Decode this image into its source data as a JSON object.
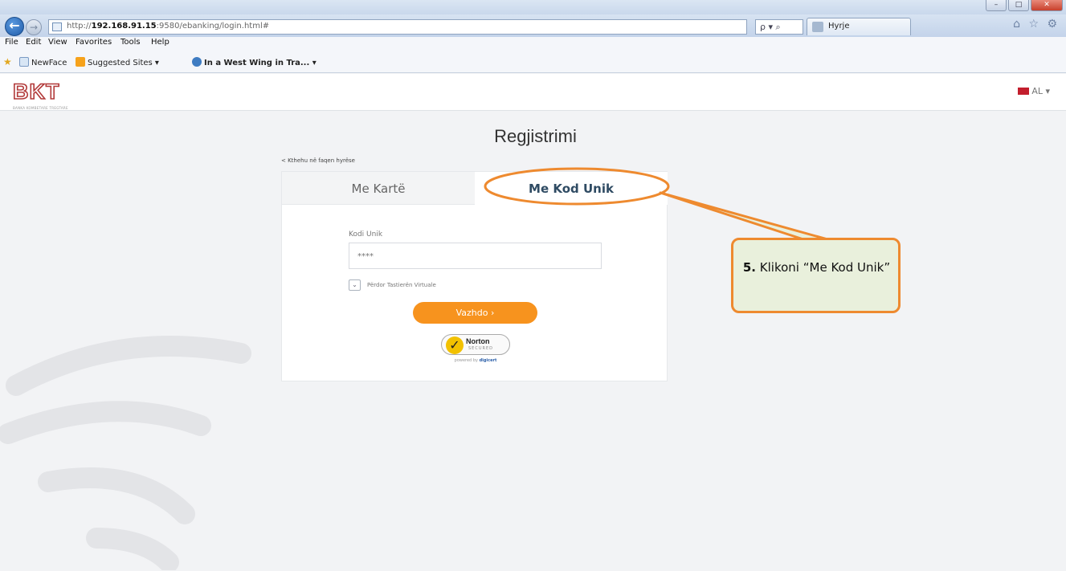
{
  "browser": {
    "url_prefix": "http://",
    "url_host": "192.168.91.15",
    "url_suffix": ":9580/ebanking/login.html#",
    "search_controls": "ρ ▾ ⌕",
    "tab_title": "Hyrje",
    "window_controls": [
      "–",
      "□",
      "✕"
    ],
    "menu": [
      "File",
      "Edit",
      "View",
      "Favorites",
      "Tools",
      "Help"
    ],
    "favorites": [
      "NewFace",
      "Suggested Sites ▾",
      "In a West Wing in Tra... ▾"
    ]
  },
  "site": {
    "logo": "BKT",
    "logo_sub": "BANKA KOMBETARE TREGTARE",
    "language": "AL ▾"
  },
  "page": {
    "title": "Regjistrimi",
    "back_link": "< Kthehu në faqen hyrëse",
    "tabs": {
      "card": "Me Kartë",
      "code": "Me Kod Unik"
    },
    "field_label": "Kodi Unik",
    "field_placeholder": "****",
    "checkbox_label": "Përdor Tastierën Virtuale",
    "submit_label": "Vazhdo ›",
    "norton": {
      "name": "Norton",
      "secured": "SECURED",
      "powered_prefix": "powered by",
      "powered_brand": "digicert"
    }
  },
  "annotation": {
    "step_number": "5.",
    "text": "Klikoni “Me Kod Unik”",
    "color": "#ee8a2f",
    "fill": "#e9f0dc"
  }
}
